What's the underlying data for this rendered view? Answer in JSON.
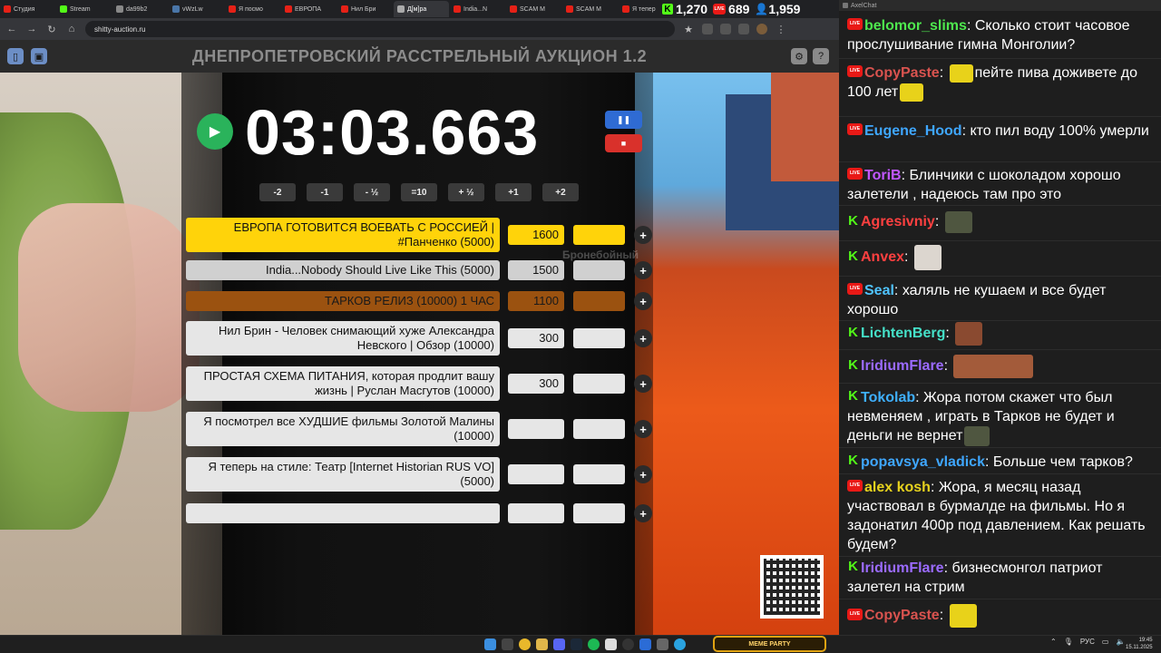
{
  "browser": {
    "tabs": [
      {
        "label": "Студия",
        "color": "#e62117"
      },
      {
        "label": "Stream",
        "color": "#53fc18"
      },
      {
        "label": "da99b2",
        "color": "#888888"
      },
      {
        "label": "vWzLw",
        "color": "#4a76a8"
      },
      {
        "label": "Я посмо",
        "color": "#e62117"
      },
      {
        "label": "ЕВРОПА",
        "color": "#e62117"
      },
      {
        "label": "Нил Бри",
        "color": "#e62117"
      },
      {
        "label": "Д[м]ра",
        "color": "#aaaaaa"
      },
      {
        "label": "India...N",
        "color": "#e62117"
      },
      {
        "label": "SCAM M",
        "color": "#e62117"
      },
      {
        "label": "SCAM M",
        "color": "#e62117"
      },
      {
        "label": "Я тепер",
        "color": "#e62117"
      }
    ],
    "stats": {
      "kick_viewers": "1,270",
      "live_viewers": "689",
      "total_viewers": "1,959"
    },
    "url": "shitty-auction.ru"
  },
  "app": {
    "title": "ДНЕПРОПЕТРОВСКИЙ РАССТРЕЛЬНЫЙ АУКЦИОН 1.2",
    "timer": "03:03.663",
    "adjusters": [
      "-2",
      "-1",
      "- ½",
      "=10",
      "+ ½",
      "+1",
      "+2"
    ],
    "lots": [
      {
        "name": "ЕВРОПА ГОТОВИТСЯ ВОЕВАТЬ С РОССИЕЙ | #Панченко (5000)",
        "sum": "1600",
        "style": "gold"
      },
      {
        "name": "India...Nobody Should Live Like This (5000)",
        "sum": "1500",
        "style": "silver"
      },
      {
        "name": "ТАРКОВ РЕЛИЗ (10000) 1 ЧАС",
        "sum": "1100",
        "style": "brown"
      },
      {
        "name": "Нил Брин - Человек снимающий хуже Александра Невского | Обзор (10000)",
        "sum": "300",
        "style": "plain"
      },
      {
        "name": "ПРОСТАЯ СХЕМА ПИТАНИЯ, которая продлит вашу жизнь | Руслан Масгутов (10000)",
        "sum": "300",
        "style": "plain"
      },
      {
        "name": "Я посмотрел все ХУДШИЕ фильмы Золотой Малины (10000)",
        "sum": "",
        "style": "plain"
      },
      {
        "name": "Я теперь на стиле: Театр [Internet Historian RUS VO] (5000)",
        "sum": "",
        "style": "plain"
      },
      {
        "name": "",
        "sum": "",
        "style": "plain"
      }
    ],
    "overlay_text": "Бронебойный"
  },
  "taskbar": {
    "meme_widget": "MEME PARTY",
    "lang": "РУС",
    "time": "19:45",
    "date": "15.11.2025"
  },
  "chat": {
    "window_title": "AxelChat",
    "messages": [
      {
        "platform": "live",
        "nick": "belomor_slims",
        "color": "#4ee84e",
        "text": "Сколько стоит часовое прослушивание гимна Монголии?"
      },
      {
        "platform": "live",
        "nick": "CopyPaste",
        "color": "#d9534f",
        "text": "пейте пива доживете до 100 лет"
      },
      {
        "platform": "live",
        "nick": "Eugene_Hood",
        "color": "#3fa7ff",
        "text": "кто пил воду 100% умерли"
      },
      {
        "platform": "live",
        "nick": "ToriB",
        "color": "#c257ff",
        "text": "Блинчики с шоколадом хорошо залетели , надеюсь там про это"
      },
      {
        "platform": "kick",
        "nick": "Agresivniy",
        "color": "#ff4040",
        "text": ""
      },
      {
        "platform": "kick",
        "nick": "Anvex",
        "color": "#ff4040",
        "text": ""
      },
      {
        "platform": "live",
        "nick": "Seal",
        "color": "#4fc3ff",
        "text": "халяль не кушаем и все будет хорошо"
      },
      {
        "platform": "kick",
        "nick": "LichtenBerg",
        "color": "#45e0c8",
        "text": ""
      },
      {
        "platform": "kick",
        "nick": "IridiumFlare",
        "color": "#9b6bff",
        "text": ""
      },
      {
        "platform": "kick",
        "nick": "Tokolab",
        "color": "#3fb0ff",
        "text": "Жора потом скажет что был невменяем , играть в Тарков не будет и деньги не вернет"
      },
      {
        "platform": "kick",
        "nick": "popavsya_vladick",
        "color": "#3fa7ff",
        "text": "Больше чем тарков?"
      },
      {
        "platform": "live",
        "nick": "alex kosh",
        "color": "#e6d21e",
        "text": "Жора, я месяц назад участвовал в бурмалде на фильмы. Но я задонатил 400р под давлением. Как решать будем?"
      },
      {
        "platform": "kick",
        "nick": "IridiumFlare",
        "color": "#9b6bff",
        "text": "бизнесмонгол патриот залетел на стрим"
      },
      {
        "platform": "live",
        "nick": "CopyPaste",
        "color": "#d9534f",
        "text": ""
      }
    ]
  }
}
